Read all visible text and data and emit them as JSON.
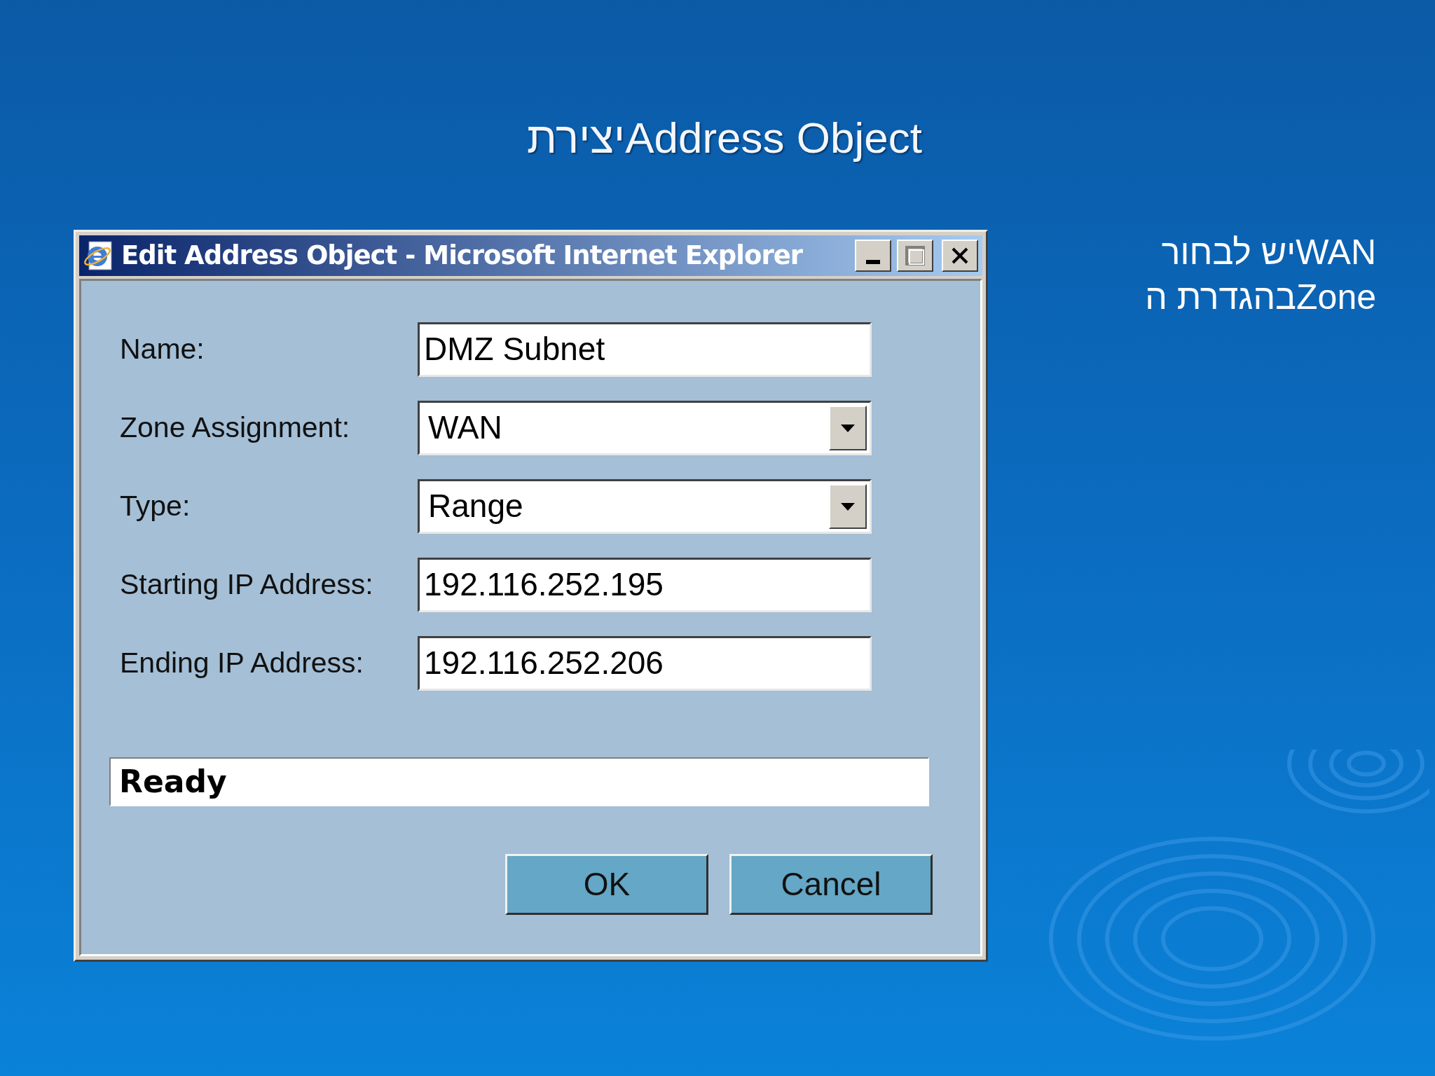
{
  "slide_title": "יצירתAddress Object",
  "note_lines": [
    "יש לבחורWAN",
    "בהגדרת הZone"
  ],
  "window": {
    "title": "Edit Address Object - Microsoft Internet Explorer"
  },
  "fields": [
    {
      "label": "Name:",
      "kind": "text",
      "value": "DMZ Subnet"
    },
    {
      "label": "Zone Assignment:",
      "kind": "select",
      "value": "WAN"
    },
    {
      "label": "Type:",
      "kind": "select",
      "value": "Range"
    },
    {
      "label": "Starting IP Address:",
      "kind": "text",
      "value": "192.116.252.195"
    },
    {
      "label": "Ending IP Address:",
      "kind": "text",
      "value": "192.116.252.206"
    }
  ],
  "status_bar": "Ready",
  "buttons": [
    "OK",
    "Cancel"
  ]
}
